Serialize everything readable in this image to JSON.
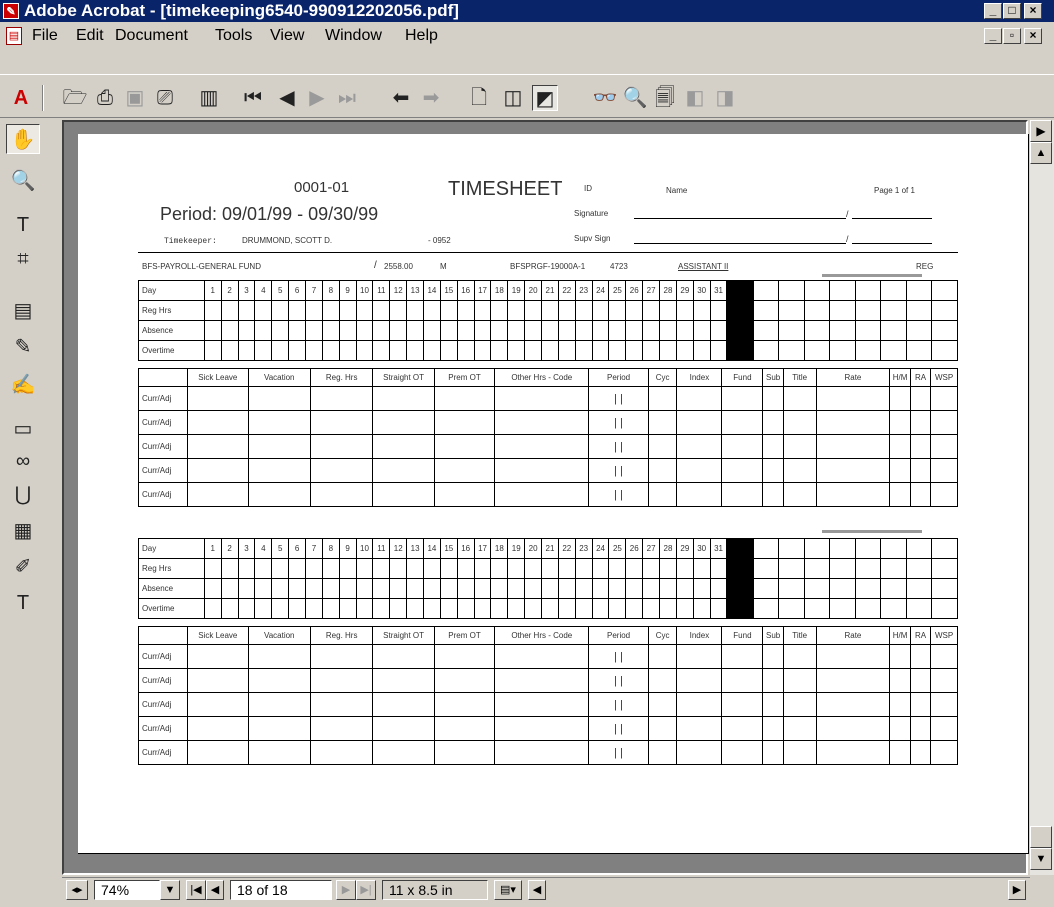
{
  "window": {
    "title": "Adobe Acrobat - [timekeeping6540-990912202056.pdf]",
    "controls_outer": [
      "_",
      "□",
      "×"
    ],
    "controls_inner": [
      "_",
      "▫",
      "×"
    ]
  },
  "menu": {
    "items": [
      "File",
      "Edit",
      "Document",
      "Tools",
      "View",
      "Window",
      "Help"
    ]
  },
  "toolbar": {
    "icons": [
      "open-icon",
      "acquire-icon",
      "save-icon",
      "print-icon",
      "show-bookmarks-icon",
      "first-page-icon",
      "previous-page-icon",
      "next-page-icon",
      "last-page-icon",
      "go-back-icon",
      "go-forward-icon",
      "actual-size-icon",
      "fit-page-icon",
      "fit-width-icon",
      "find-icon",
      "search-icon",
      "search-results-icon",
      "previous-highlight-icon",
      "next-highlight-icon"
    ]
  },
  "left_tools": {
    "icons": [
      "hand-tool-icon",
      "zoom-tool-icon",
      "text-select-tool-icon",
      "crop-tool-icon",
      "note-tool-icon",
      "pencil-tool-icon",
      "highlight-tool-icon",
      "movie-tool-icon",
      "link-tool-icon",
      "article-tool-icon",
      "form-tool-icon",
      "signature-tool-icon",
      "touchup-text-tool-icon"
    ]
  },
  "document": {
    "code": "0001-01",
    "heading": "TIMESHEET",
    "period": "Period:  09/01/99 - 09/30/99",
    "timekeeper_label": "Timekeeper:",
    "timekeeper_name": "DRUMMOND, SCOTT D.",
    "timekeeper_ext": "- 0952",
    "id_label": "ID",
    "name_label": "Name",
    "page_label": "Page  1   of  1",
    "signature_label": "Signature",
    "supv_sign_label": "Supv Sign",
    "slash": "/",
    "fund": "BFS-PAYROLL-GENERAL FUND",
    "amount": "2558.00",
    "amount_slash": "/",
    "code_m": "M",
    "acct": "BFSPRGF-19000A-1",
    "num": "4723",
    "position": "ASSISTANT II",
    "reg": "REG"
  },
  "timesheet": {
    "day_label": "Day",
    "row_labels": [
      "Reg Hrs",
      "Absence",
      "Overtime"
    ],
    "days": [
      "1",
      "2",
      "3",
      "4",
      "5",
      "6",
      "7",
      "8",
      "9",
      "10",
      "11",
      "12",
      "13",
      "14",
      "15",
      "16",
      "17",
      "18",
      "19",
      "20",
      "21",
      "22",
      "23",
      "24",
      "25",
      "26",
      "27",
      "28",
      "29",
      "30",
      "31"
    ],
    "col_headers": [
      "Sick Leave",
      "Vacation",
      "Reg. Hrs",
      "Straight OT",
      "Prem OT",
      "Other Hrs - Code",
      "Period",
      "Cyc",
      "Index",
      "Fund",
      "Sub",
      "Title",
      "Rate",
      "H/M",
      "RA",
      "WSP"
    ],
    "adj_label": "Curr/Adj",
    "period_marks": "|   |"
  },
  "statusbar": {
    "zoom": "74%",
    "page": "18 of 18",
    "page_size": "11 x 8.5 in"
  }
}
